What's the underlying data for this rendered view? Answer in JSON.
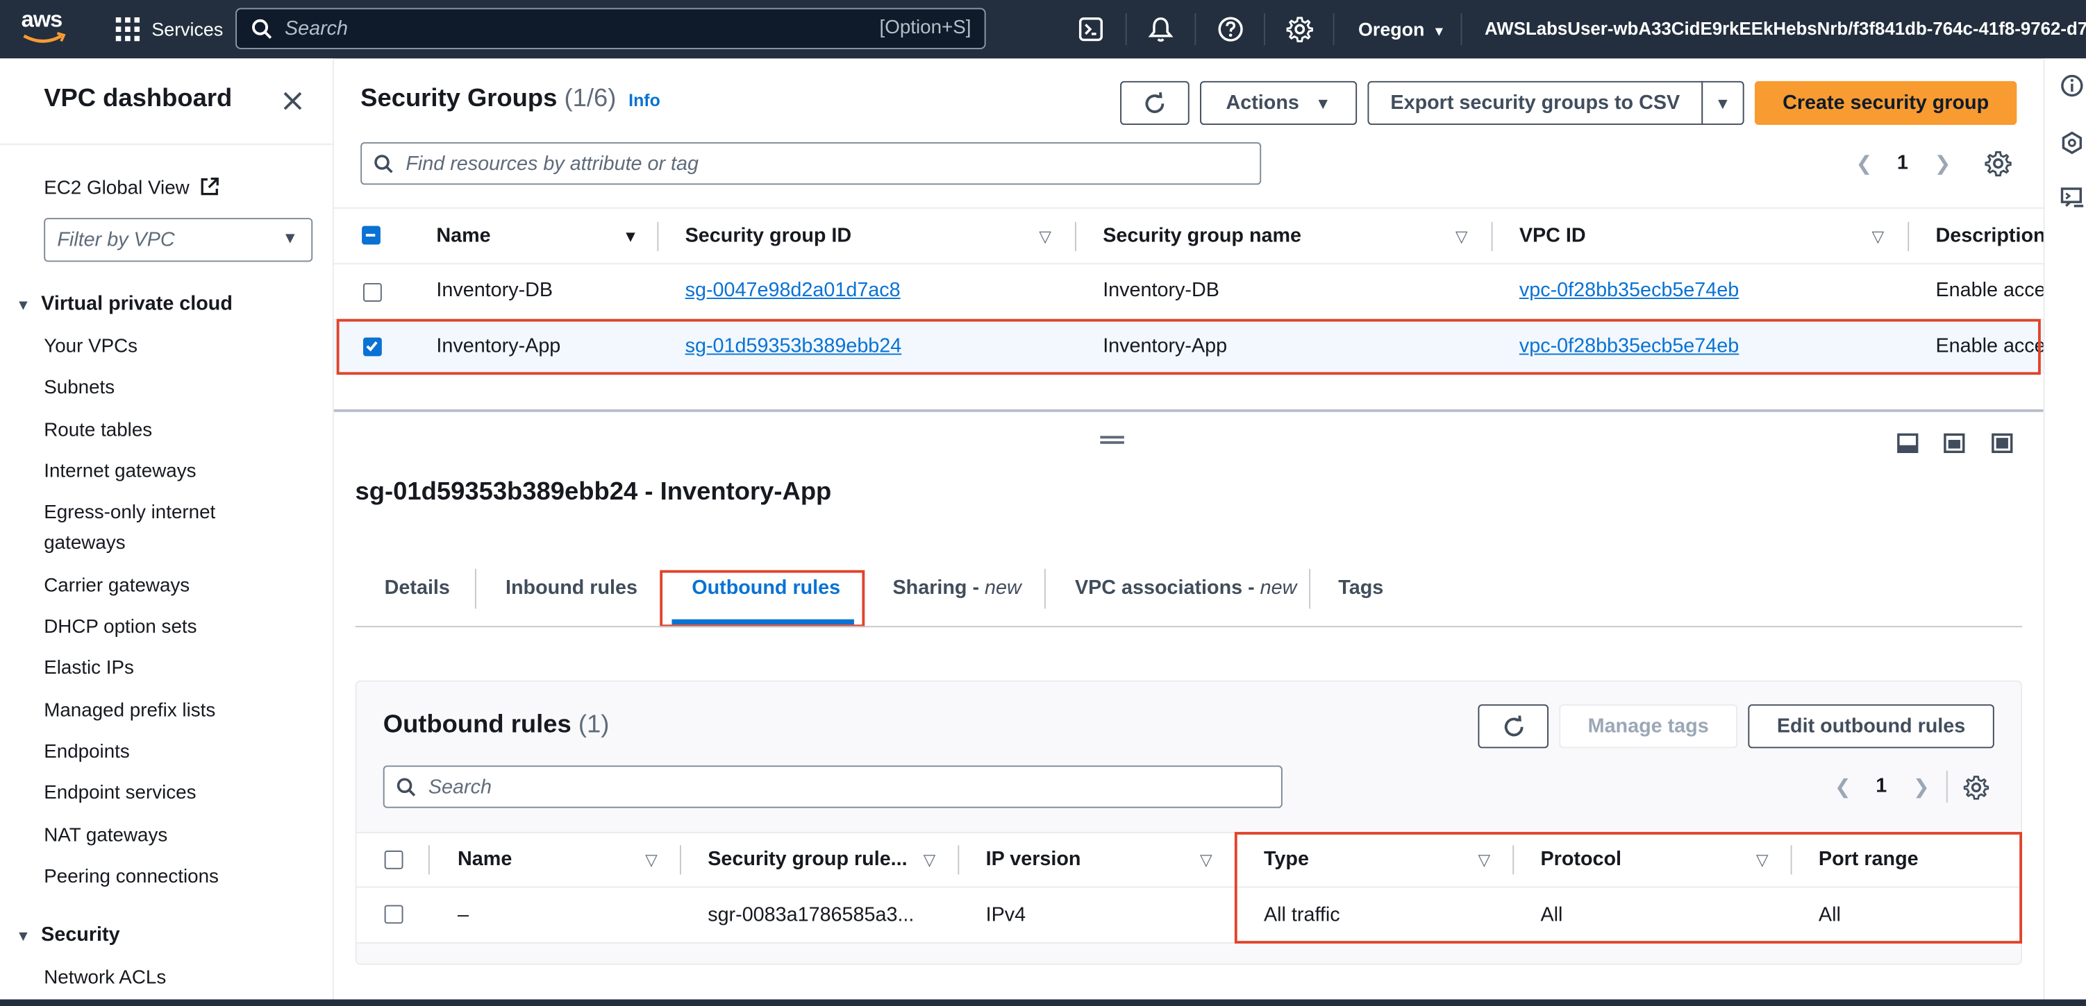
{
  "topnav": {
    "logo": "aws",
    "services": "Services",
    "search_placeholder": "Search",
    "search_shortcut": "[Option+S]",
    "region": "Oregon",
    "user": "AWSLabsUser-wbA33CidE9rkEEkHebsNrb/f3f841db-764c-41f8-9762-d7..."
  },
  "sidebar": {
    "title": "VPC dashboard",
    "ec2_global_view": "EC2 Global View",
    "filter_placeholder": "Filter by VPC",
    "section_vpc": "Virtual private cloud",
    "items": [
      "Your VPCs",
      "Subnets",
      "Route tables",
      "Internet gateways",
      "Egress-only internet",
      "gateways",
      "Carrier gateways",
      "DHCP option sets",
      "Elastic IPs",
      "Managed prefix lists",
      "Endpoints",
      "Endpoint services",
      "NAT gateways",
      "Peering connections"
    ],
    "section_security": "Security",
    "security_items": [
      "Network ACLs"
    ]
  },
  "sg_header": {
    "title": "Security Groups",
    "count": "(1/6)",
    "info": "Info",
    "actions": "Actions",
    "export": "Export security groups to CSV",
    "create": "Create security group",
    "search_placeholder": "Find resources by attribute or tag",
    "page": "1"
  },
  "sg_table": {
    "columns": [
      "Name",
      "Security group ID",
      "Security group name",
      "VPC ID",
      "Description"
    ],
    "rows": [
      {
        "name": "Inventory-DB",
        "sg_id": "sg-0047e98d2a01d7ac8",
        "sg_name": "Inventory-DB",
        "vpc_id": "vpc-0f28bb35ecb5e74eb",
        "description": "Enable access",
        "checked": false
      },
      {
        "name": "Inventory-App",
        "sg_id": "sg-01d59353b389ebb24",
        "sg_name": "Inventory-App",
        "vpc_id": "vpc-0f28bb35ecb5e74eb",
        "description": "Enable access",
        "checked": true
      }
    ]
  },
  "detail": {
    "title": "sg-01d59353b389ebb24 - Inventory-App",
    "tabs": [
      {
        "label": "Details"
      },
      {
        "label": "Inbound rules"
      },
      {
        "label": "Outbound rules",
        "active": true
      },
      {
        "label": "Sharing - ",
        "suffix": "new"
      },
      {
        "label": "VPC associations - ",
        "suffix": "new"
      },
      {
        "label": "Tags"
      }
    ]
  },
  "outbound": {
    "title": "Outbound rules",
    "count": "(1)",
    "manage_tags": "Manage tags",
    "edit": "Edit outbound rules",
    "search_placeholder": "Search",
    "page": "1",
    "columns": [
      "Name",
      "Security group rule...",
      "IP version",
      "Type",
      "Protocol",
      "Port range"
    ],
    "rows": [
      {
        "name": "–",
        "rule_id": "sgr-0083a1786585a3...",
        "ip_version": "IPv4",
        "type": "All traffic",
        "protocol": "All",
        "port_range": "All"
      }
    ]
  },
  "colors": {
    "nav_bg": "#232f3e",
    "accent": "#0972d3",
    "primary_button": "#f89b31",
    "highlight": "#e0442a"
  }
}
